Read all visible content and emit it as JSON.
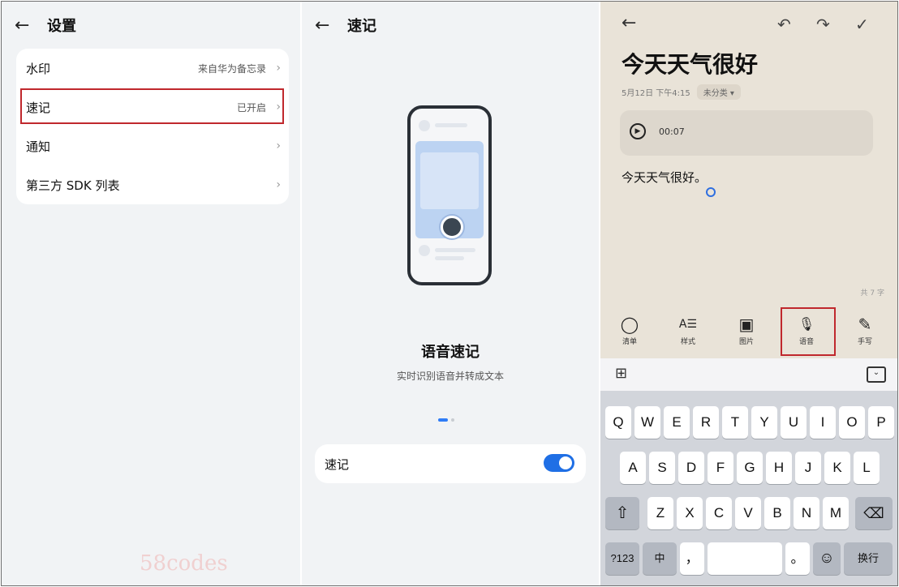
{
  "settings": {
    "back_glyph": "←",
    "title": "设置",
    "rows": [
      {
        "label": "水印",
        "value": "来自华为备忘录",
        "chevron": "›"
      },
      {
        "label": "速记",
        "value": "已开启",
        "chevron": "›"
      },
      {
        "label": "通知",
        "value": "",
        "chevron": "›"
      },
      {
        "label": "第三方 SDK 列表",
        "value": "",
        "chevron": "›"
      }
    ],
    "highlight_color": "#c0282d"
  },
  "quicknote": {
    "back_glyph": "←",
    "title": "速记",
    "feature_title": "语音速记",
    "feature_subtitle": "实时识别语音并转成文本",
    "toggle_label": "速记",
    "toggle_on": true,
    "accent": "#1f6fe5"
  },
  "editor": {
    "back_glyph": "←",
    "undo_glyph": "↶",
    "redo_glyph": "↷",
    "done_glyph": "✓",
    "note_title": "今天天气很好",
    "date": "5月12日 下午4:15",
    "category": "未分类 ▾",
    "audio_time": "00:07",
    "play_glyph": "▶",
    "body": "今天天气很好。",
    "word_count": "共 7 字",
    "tools": [
      {
        "icon": "◯",
        "label": "清单"
      },
      {
        "icon": "A☰",
        "label": "样式"
      },
      {
        "icon": "▣",
        "label": "图片"
      },
      {
        "icon": "🎙",
        "label": "语音"
      },
      {
        "icon": "✎",
        "label": "手写"
      }
    ]
  },
  "keyboard": {
    "grid_glyph": "⊞",
    "collapse_glyph": "⌄",
    "row1": [
      "Q",
      "W",
      "E",
      "R",
      "T",
      "Y",
      "U",
      "I",
      "O",
      "P"
    ],
    "row2": [
      "A",
      "S",
      "D",
      "F",
      "G",
      "H",
      "J",
      "K",
      "L"
    ],
    "row3": [
      "Z",
      "X",
      "C",
      "V",
      "B",
      "N",
      "M"
    ],
    "shift_glyph": "⇧",
    "delete_glyph": "⌫",
    "num_key": "?123",
    "lang_key": "中",
    "comma_key": "，",
    "period_key": "。",
    "emoji_glyph": "☺",
    "enter_key": "换行"
  },
  "watermark": "58codes"
}
